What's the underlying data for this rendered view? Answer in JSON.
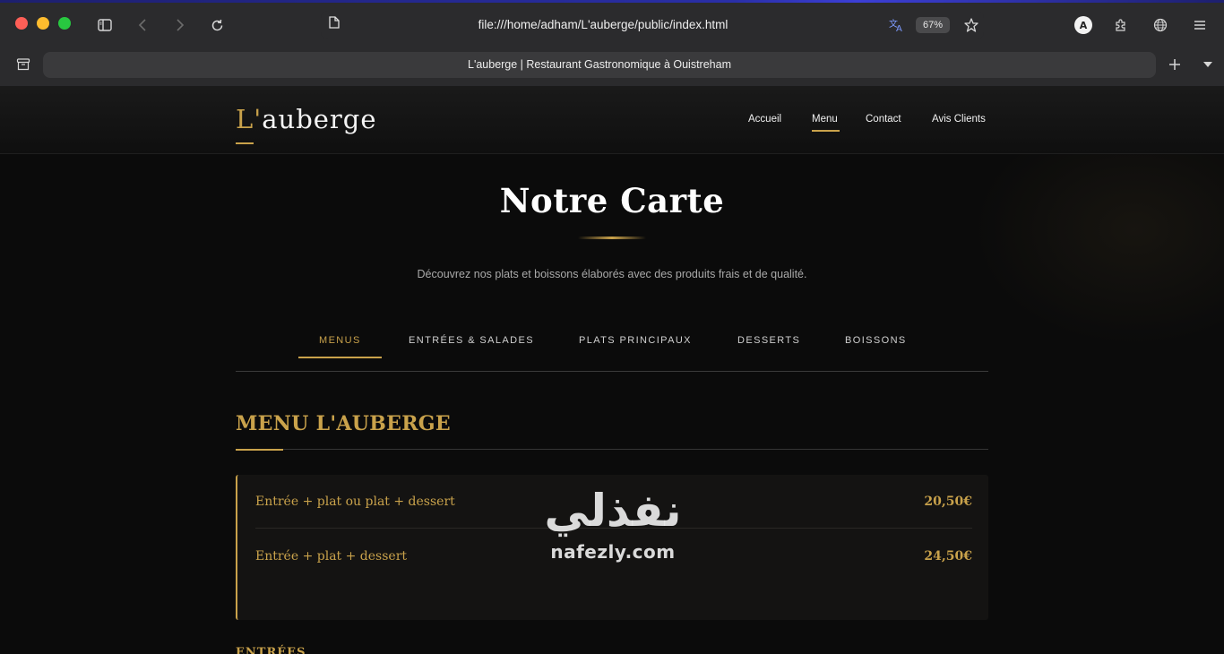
{
  "browser": {
    "url": "file:///home/adham/L'auberge/public/index.html",
    "zoom": "67%",
    "tab_title": "L'auberge | Restaurant Gastronomique à Ouistreham",
    "profile_initial": "A",
    "icons": [
      "sidebar-icon",
      "back-icon",
      "forward-icon",
      "reload-icon",
      "document-icon",
      "translate-icon",
      "bookmark-star-icon",
      "profile-icon",
      "extensions-icon",
      "globe-icon",
      "menu-icon",
      "tab-archive-icon",
      "new-tab-icon",
      "tab-list-chevron-icon"
    ]
  },
  "site": {
    "logo_accent": "L'",
    "logo_rest": "auberge",
    "nav": [
      {
        "label": "Accueil"
      },
      {
        "label": "Menu",
        "active": true
      },
      {
        "label": "Contact"
      },
      {
        "label": "Avis Clients"
      }
    ]
  },
  "hero": {
    "title": "Notre Carte",
    "subtitle": "Découvrez nos plats et boissons élaborés avec des produits frais et de qualité."
  },
  "categories": [
    {
      "label": "MENUS",
      "active": true
    },
    {
      "label": "ENTRÉES & SALADES"
    },
    {
      "label": "PLATS PRINCIPAUX"
    },
    {
      "label": "DESSERTS"
    },
    {
      "label": "BOISSONS"
    }
  ],
  "menu_section": {
    "title": "MENU L'AUBERGE",
    "items": [
      {
        "name": "Entrée + plat ou plat + dessert",
        "price": "20,50€"
      },
      {
        "name": "Entrée + plat + dessert",
        "price": "24,50€"
      }
    ]
  },
  "next_section_title": "ENTRÉES",
  "watermark": {
    "arabic": "نفذلي",
    "latin": "nafezly.com"
  },
  "colors": {
    "gold": "#c9a24b",
    "background": "#0b0b0b",
    "chrome": "#2b2b2d"
  }
}
